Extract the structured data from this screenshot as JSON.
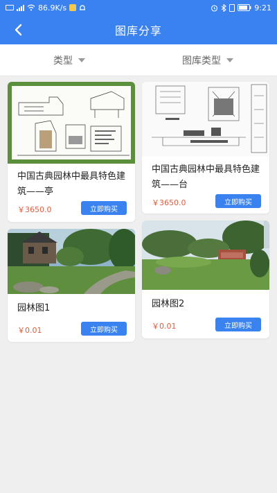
{
  "status": {
    "speed": "86.9K/s",
    "time": "9:21"
  },
  "header": {
    "title": "图库分享"
  },
  "filters": [
    {
      "label": "类型"
    },
    {
      "label": "图库类型"
    }
  ],
  "items": [
    {
      "name": "中国古典园林中最具特色建筑——亭",
      "price": "￥3650.0",
      "button": "立即购买"
    },
    {
      "name": "中国古典园林中最具特色建筑——台",
      "price": "￥3650.0",
      "button": "立即购买"
    },
    {
      "name": "园林图1",
      "price": "￥0.01",
      "button": "立即购买"
    },
    {
      "name": "园林图2",
      "price": "￥0.01",
      "button": "立即购买"
    }
  ]
}
